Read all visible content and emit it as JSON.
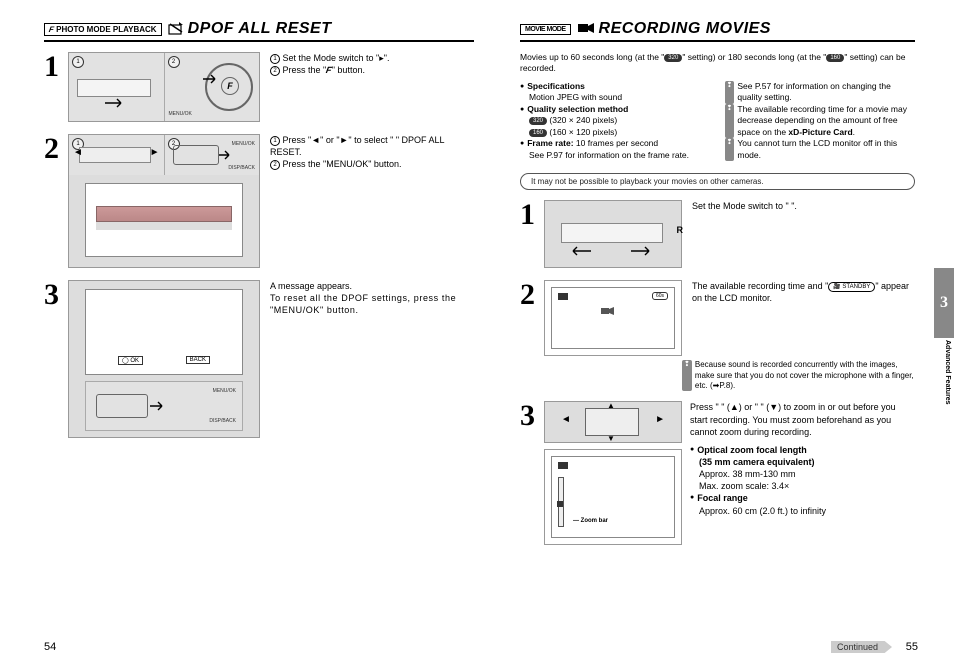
{
  "left": {
    "modeBox": "PHOTO MODE   PLAYBACK",
    "modeF": "F",
    "iconHint": "dpof-reset-icon",
    "title": "DPOF ALL RESET",
    "steps": {
      "s1": {
        "line1a": "Set the Mode switch to \"",
        "line1b": "\".",
        "line2a": "Press the \"",
        "line2b": "\" button."
      },
      "s2": {
        "line1": "Press \"◄\" or \"►\" to select \"  \" DPOF ALL RESET.",
        "line2": "Press the \"MENU/OK\" button."
      },
      "s3": {
        "line1": "A message appears.",
        "line2": "To reset all the DPOF settings, press the \"MENU/OK\" button."
      }
    },
    "ill_labels": {
      "menuok": "MENU/OK",
      "dispback": "DISP/BACK",
      "ok": "OK",
      "back": "BACK"
    },
    "pageNumber": "54"
  },
  "right": {
    "modeBox": "MOVIE MODE",
    "iconHint": "recording-movies-icon",
    "title": "RECORDING MOVIES",
    "intro_a": "Movies up to 60 seconds long (at the \"",
    "intro_tag1": "320",
    "intro_b": "\" setting) or 180 seconds long (at the \"",
    "intro_tag2": "160",
    "intro_c": "\" setting) can be recorded.",
    "specs": {
      "h1": "Specifications",
      "l1": "Motion JPEG    with sound",
      "h2": "Quality selection method",
      "q1tag": "320",
      "q1": "(320 × 240 pixels)",
      "q2tag": "160",
      "q2": "(160 × 120 pixels)",
      "h3_a": "Frame rate:",
      "h3_b": " 10 frames per second",
      "l3": "See P.97 for information on the frame rate."
    },
    "notesRight": {
      "n1": "See P.57 for information on changing the quality setting.",
      "n2a": "The available recording time for a movie may decrease depending on the amount of free space on the ",
      "n2b": "xD-Picture Card",
      "n2c": ".",
      "n3": "You cannot turn the LCD monitor off in this mode."
    },
    "pill": "It may not be possible to playback your movies on other cameras.",
    "step1": "Set the Mode switch to \"   \".",
    "step2_a": "The available recording time and \"",
    "step2_tag": "  STANDBY",
    "step2_b": "\" appear on the LCD monitor.",
    "note2": "Because sound is recorded concurrently with the images, make sure that you do not cover the microphone with a finger, etc. (➡P.8).",
    "step3": {
      "line1": "Press \"   \" (▲) or \"   \" (▼) to zoom in or out before you start recording. You must zoom beforehand as you cannot zoom during recording.",
      "h1": "Optical zoom focal length",
      "h1b": "(35 mm camera equivalent)",
      "l1": "Approx. 38 mm-130 mm",
      "l2": "Max. zoom scale: 3.4×",
      "h2": "Focal range",
      "l3": "Approx. 60 cm (2.0 ft.) to infinity"
    },
    "zoomBar": "Zoom bar",
    "pageNumber": "55",
    "continued": "Continued",
    "sideTab": "3",
    "sideLabel": "Advanced Features"
  }
}
